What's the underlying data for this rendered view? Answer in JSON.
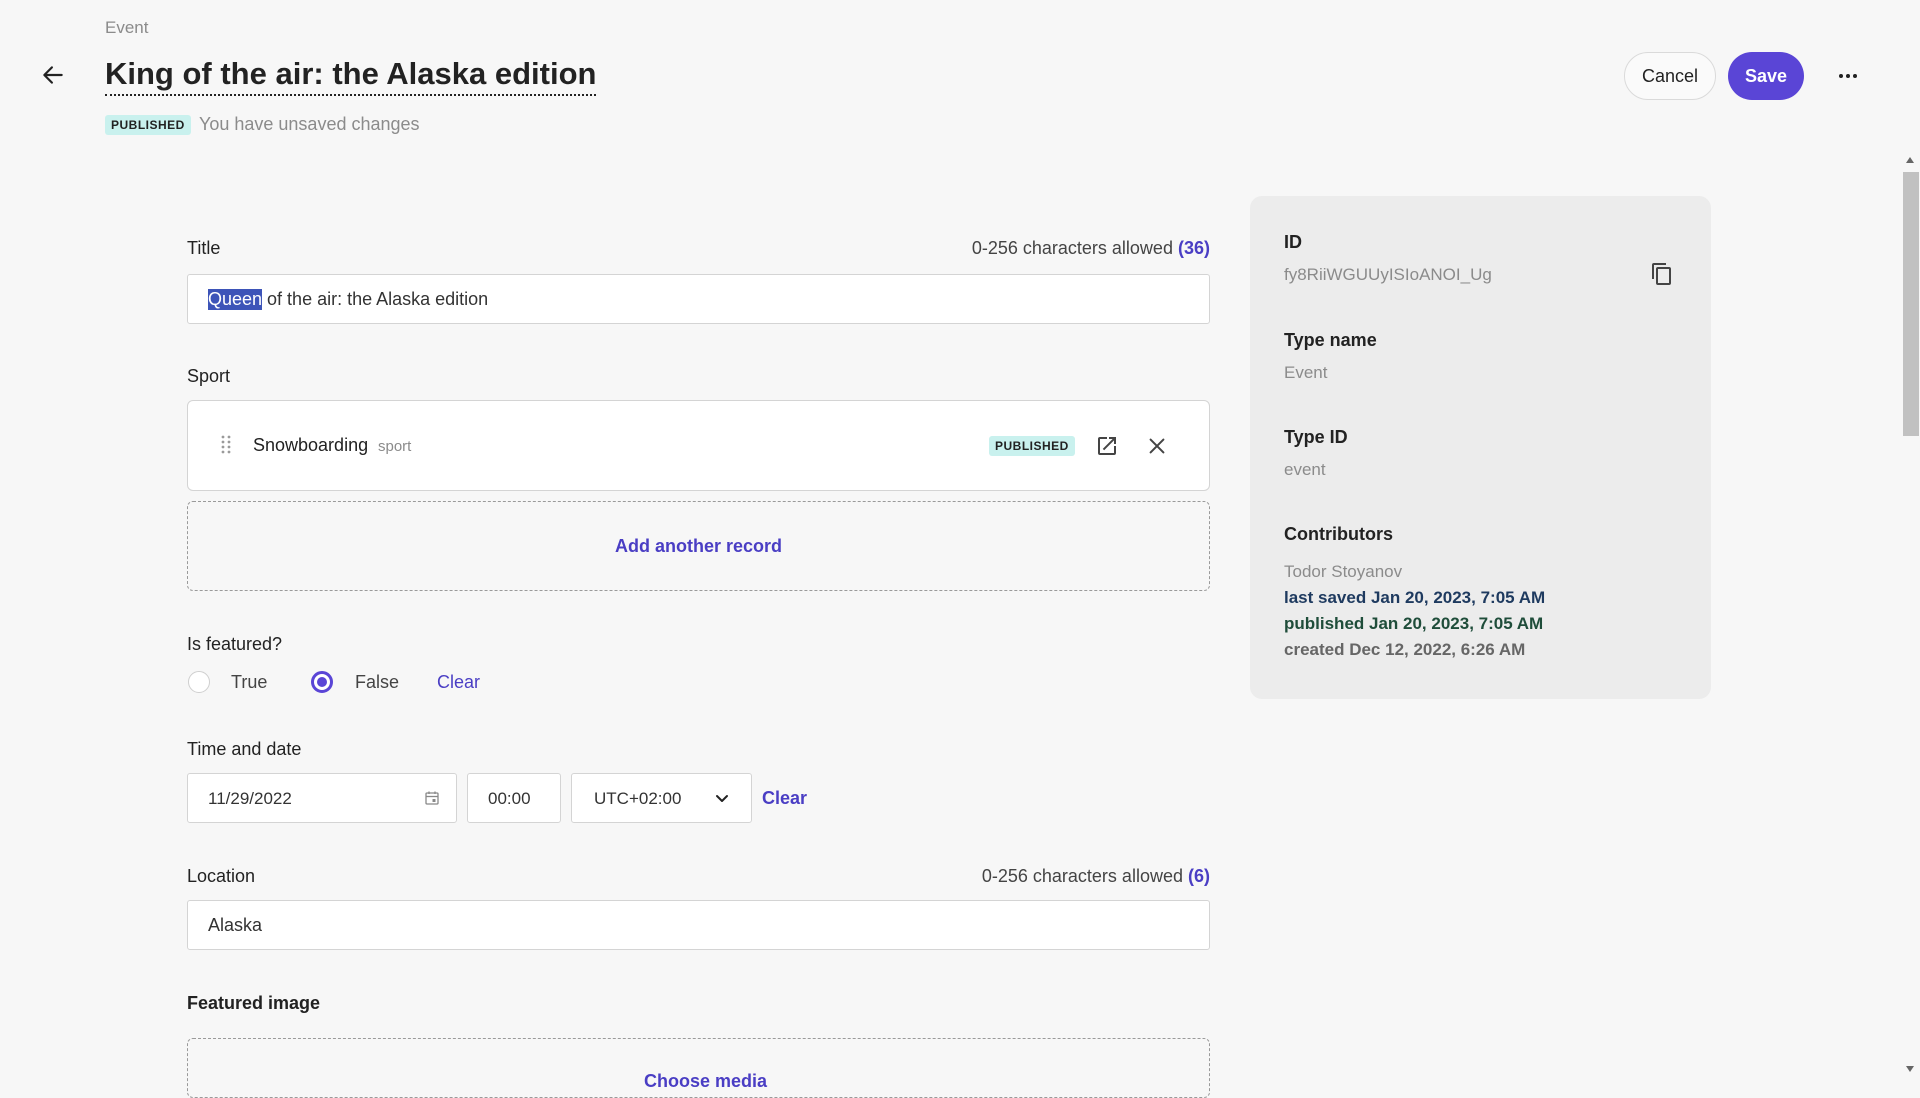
{
  "header": {
    "breadcrumb": "Event",
    "title": "King of the air: the Alaska edition",
    "status_badge": "PUBLISHED",
    "unsaved_text": "You have unsaved changes",
    "cancel_label": "Cancel",
    "save_label": "Save"
  },
  "form": {
    "title": {
      "label": "Title",
      "counter_text": "0-256 characters allowed",
      "counter_value": "(36)",
      "value_selected": "Queen",
      "value_rest": " of the air: the Alaska edition"
    },
    "sport": {
      "label": "Sport",
      "record_name": "Snowboarding",
      "record_type": "sport",
      "record_badge": "PUBLISHED",
      "add_label": "Add another record"
    },
    "featured": {
      "label": "Is featured?",
      "option_true": "True",
      "option_false": "False",
      "selected": "False",
      "clear_label": "Clear"
    },
    "datetime": {
      "label": "Time and date",
      "date": "11/29/2022",
      "time": "00:00",
      "timezone": "UTC+02:00",
      "clear_label": "Clear"
    },
    "location": {
      "label": "Location",
      "counter_text": "0-256 characters allowed",
      "counter_value": "(6)",
      "value": "Alaska"
    },
    "featured_image": {
      "label": "Featured image",
      "button_partial": "Choose media"
    }
  },
  "sidebar": {
    "id_label": "ID",
    "id_value": "fy8RiiWGUUyISIoANOI_Ug",
    "type_name_label": "Type name",
    "type_name_value": "Event",
    "type_id_label": "Type ID",
    "type_id_value": "event",
    "contributors_label": "Contributors",
    "contributor_name": "Todor Stoyanov",
    "last_saved": "last saved Jan 20, 2023, 7:05 AM",
    "published": "published Jan 20, 2023, 7:05 AM",
    "created": "created Dec 12, 2022, 6:26 AM"
  },
  "colors": {
    "accent": "#5a45d6",
    "badge_bg": "#c9f1ee",
    "published_text": "#1f4d3a",
    "last_saved_text": "#1e3a5f"
  }
}
